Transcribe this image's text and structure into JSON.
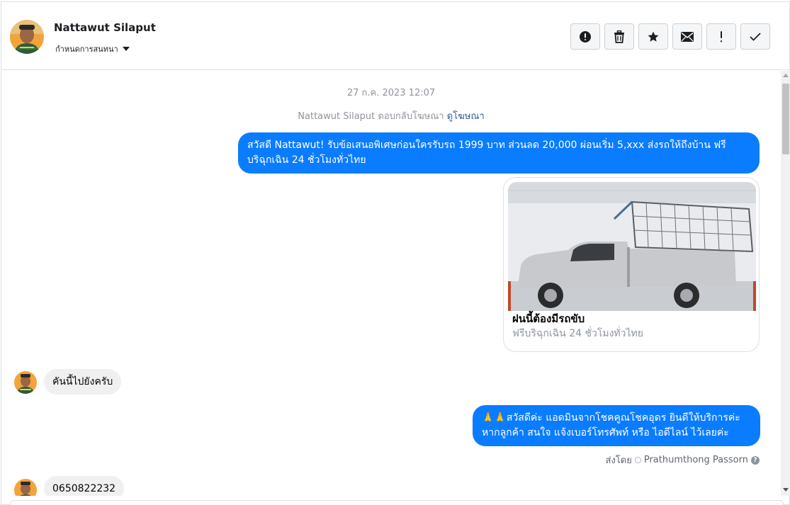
{
  "header": {
    "name": "Nattawut Silaput",
    "assign_label": "กำหนดการสนทนา",
    "toolbar": [
      {
        "id": "spam",
        "icon": "alert-circle-icon"
      },
      {
        "id": "delete",
        "icon": "trash-icon"
      },
      {
        "id": "star",
        "icon": "star-icon"
      },
      {
        "id": "mark-unread",
        "icon": "envelope-icon"
      },
      {
        "id": "follow-up",
        "icon": "exclamation-icon"
      },
      {
        "id": "done",
        "icon": "check-icon"
      }
    ]
  },
  "conversation": {
    "timestamp": "27 ก.ค. 2023 12:07",
    "ad_reply": {
      "text": "Nattawut Silaput ตอบกลับโฆษณา",
      "link": "ดูโฆษณา"
    },
    "messages": [
      {
        "direction": "out",
        "text_lines": [
          "สวัสดี Nattawut! รับข้อเสนอพิเศษก่อนใครรับรถ 1999 บาท ส่วนลด 20,000  ผ่อนเริ่ม 5,xxx ส่งรถให้ถึงบ้าน ฟรี",
          "บริฉุกเฉิน 24 ชั่วโมงทั่วไทย"
        ]
      },
      {
        "direction": "out",
        "type": "card",
        "title": "ฝนนี้ต้องมีรถขับ",
        "subtitle": "ฟรีบริฉุกเฉิน 24 ชั่วโมงทั่วไทย"
      },
      {
        "direction": "in",
        "text": "คันนี้ไปยังครับ"
      },
      {
        "direction": "out",
        "text_lines": [
          "🙏🙏สวัสดีค่ะ แอดมินจากโชคคูณโชคอุดร ยินดีให้บริการค่ะ",
          "หากลูกค้า สนใจ แจ้งเบอร์โทรศัพท์ หรือ ไอดีไลน์  ไว้เลยค่ะ"
        ],
        "sent_by_label": "ส่งโดย",
        "sent_by_name": "Prathumthong Passorn"
      },
      {
        "direction": "in",
        "text": "0650822232"
      }
    ]
  },
  "colors": {
    "outgoing_bubble": "#0a7cff",
    "incoming_bubble": "#f0f0f0",
    "meta_text": "#90949c",
    "link": "#385898"
  }
}
